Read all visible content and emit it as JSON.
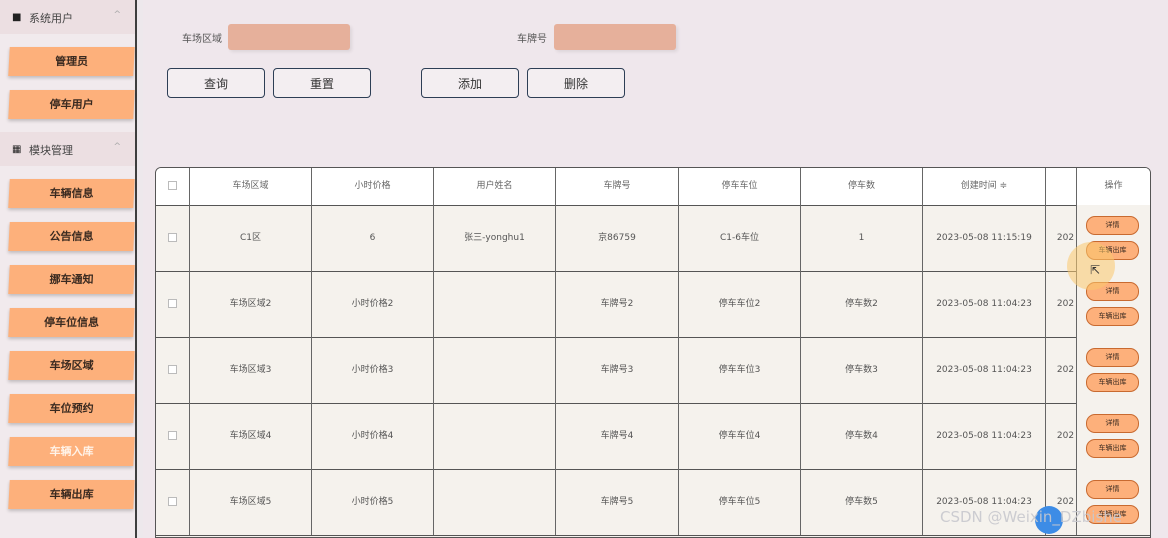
{
  "sidebar": {
    "group1": {
      "label": "系统用户",
      "icon": "user-icon"
    },
    "group1_items": [
      "管理员",
      "停车用户"
    ],
    "group2": {
      "label": "模块管理",
      "icon": "grid-icon"
    },
    "group2_items": [
      "车辆信息",
      "公告信息",
      "挪车通知",
      "停车位信息",
      "车场区域",
      "车位预约",
      "车辆入库",
      "车辆出库"
    ]
  },
  "search": {
    "area_label": "车场区域",
    "plate_label": "车牌号",
    "area_value": "",
    "plate_value": ""
  },
  "actions": {
    "query": "查询",
    "reset": "重置",
    "add": "添加",
    "delete": "删除"
  },
  "table": {
    "headers": [
      "车场区域",
      "小时价格",
      "用户姓名",
      "车牌号",
      "停车车位",
      "停车数",
      "创建时间 ≑",
      "",
      "操作"
    ],
    "rows": [
      [
        "C1区",
        "6",
        "张三-yonghu1",
        "京86759",
        "C1-6车位",
        "1",
        "2023-05-08 11:15:19",
        "202"
      ],
      [
        "车场区域2",
        "小时价格2",
        "",
        "车牌号2",
        "停车车位2",
        "停车数2",
        "2023-05-08 11:04:23",
        "202"
      ],
      [
        "车场区域3",
        "小时价格3",
        "",
        "车牌号3",
        "停车车位3",
        "停车数3",
        "2023-05-08 11:04:23",
        "202"
      ],
      [
        "车场区域4",
        "小时价格4",
        "",
        "车牌号4",
        "停车车位4",
        "停车数4",
        "2023-05-08 11:04:23",
        "202"
      ],
      [
        "车场区域5",
        "小时价格5",
        "",
        "车牌号5",
        "停车车位5",
        "停车数5",
        "2023-05-08 11:04:23",
        "202"
      ]
    ],
    "row_actions": {
      "detail": "详情",
      "exit": "车辆出库"
    }
  },
  "watermark": "CSDN @Weixin_DZbishe",
  "colors": {
    "accent": "#fdb07b",
    "input": "#e6b09b",
    "border": "#2d3e55"
  }
}
